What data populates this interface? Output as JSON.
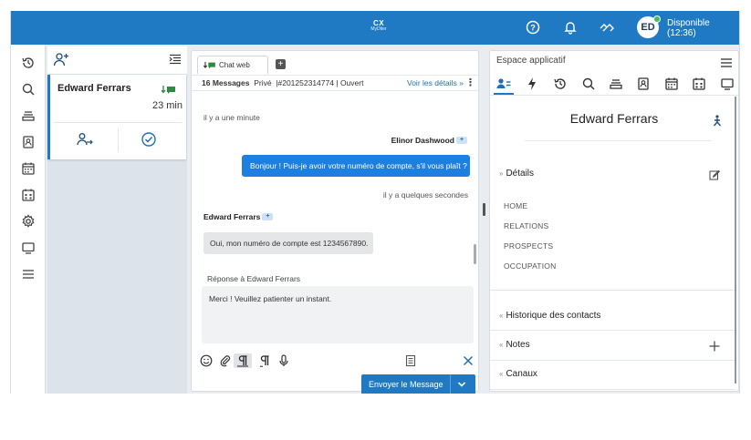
{
  "topbar": {
    "brand_main": "CX",
    "brand_sub": "MyDtier",
    "help_icon": "help-circle-icon",
    "bell_icon": "bell-icon",
    "link_icon": "unlink-icon",
    "avatar_initials": "ED",
    "status_label": "Disponible",
    "status_time": "(12:36)",
    "status_color": "#3fbf5a",
    "bar_color": "#1f7ac3"
  },
  "leftnav": {
    "items": [
      "history-icon",
      "search-icon",
      "queue-icon",
      "contact-book-icon",
      "calendar-icon",
      "schedule-icon",
      "settings-icon",
      "monitor-icon",
      "menu-icon"
    ]
  },
  "conversations": {
    "header_icons": [
      "add-user-icon",
      "list-toggle-icon"
    ],
    "items": [
      {
        "name": "Edward Ferrars",
        "channel_icon": "chat-incoming-icon",
        "duration": "23 min",
        "actions": [
          "transfer-user-icon",
          "check-circle-icon"
        ]
      }
    ]
  },
  "chat": {
    "tab_label": "Chat web",
    "add_tab": "+",
    "info": {
      "messages": "16 Messages",
      "visibility": "Privé",
      "id": "|#201252314774",
      "separator": "|",
      "status": "Ouvert",
      "details_link": "Voir les détails",
      "details_chevron": "»"
    },
    "messages": [
      {
        "type": "timestamp",
        "text": "il y a une minute"
      },
      {
        "type": "outgoing",
        "sender": "Elinor Dashwood",
        "text": "Bonjour ! Puis-je avoir votre numéro de compte, s'il vous plaît ?"
      },
      {
        "type": "timestamp",
        "text": "il y a quelques secondes"
      },
      {
        "type": "incoming",
        "sender": "Edward Ferrars",
        "text": "Oui, mon numéro de compte est 1234567890."
      }
    ],
    "reply_label": "Réponse à Edward Ferrars",
    "reply_text": "Merci ! Veuillez patienter un instant.",
    "send_label": "Envoyer le Message",
    "accent_color": "#1d7fe0"
  },
  "appspace": {
    "title": "Espace applicatif",
    "tabs": [
      "contact-icon",
      "lightning-icon",
      "history-icon",
      "search-icon",
      "queue-icon",
      "contact-book-icon",
      "calendar-icon",
      "schedule-icon",
      "monitor-icon"
    ],
    "contact_name": "Edward Ferrars",
    "sections": {
      "details": "Détails",
      "details_items": [
        "HOME",
        "RELATIONS",
        "PROSPECTS",
        "OCCUPATION"
      ],
      "history": "Historique des contacts",
      "notes": "Notes",
      "channels": "Canaux"
    }
  }
}
